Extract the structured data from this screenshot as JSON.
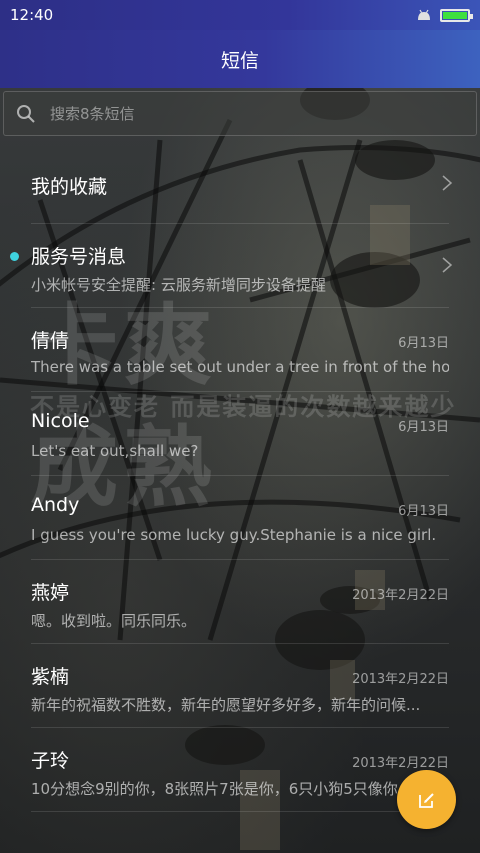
{
  "status_bar": {
    "time": "12:40",
    "android_icon": "android-icon",
    "battery_icon": "battery-icon",
    "battery_level": 1.0,
    "battery_color": "#3ee03e"
  },
  "header": {
    "title": "短信",
    "gradient_colors": [
      "#2e3088",
      "#3d62bf"
    ]
  },
  "search": {
    "placeholder": "搜索8条短信",
    "icon": "search-icon"
  },
  "background_text": {
    "line1": "卡爽",
    "line2": "不是心变老 而是装逼的次数越来越少",
    "line3": "成熟"
  },
  "favorites": {
    "label": "我的收藏",
    "icon": "chevron-right-icon"
  },
  "service": {
    "name": "服务号消息",
    "preview": "小米帐号安全提醒: 云服务新增同步设备提醒",
    "unread_dot_color": "#3fd3e0",
    "icon": "chevron-right-icon"
  },
  "conversations": [
    {
      "name": "倩倩",
      "date": "6月13日",
      "preview": "There was a table set out under a tree in front of the ho..."
    },
    {
      "name": "Nicole",
      "date": "6月13日",
      "preview": "Let's eat out,shall we?"
    },
    {
      "name": "Andy",
      "date": "6月13日",
      "preview": "I guess you're some lucky guy.Stephanie is a nice girl."
    },
    {
      "name": "燕婷",
      "date": "2013年2月22日",
      "preview": "嗯。收到啦。同乐同乐。"
    },
    {
      "name": "紫楠",
      "date": "2013年2月22日",
      "preview": "新年的祝福数不胜数，新年的愿望好多好多，新年的问候..."
    },
    {
      "name": "子玲",
      "date": "2013年2月22日",
      "preview": "10分想念9别的你，8张照片7张是你，6只小狗5只像你"
    }
  ],
  "fab": {
    "icon": "compose-icon",
    "color": "#f5b230"
  }
}
